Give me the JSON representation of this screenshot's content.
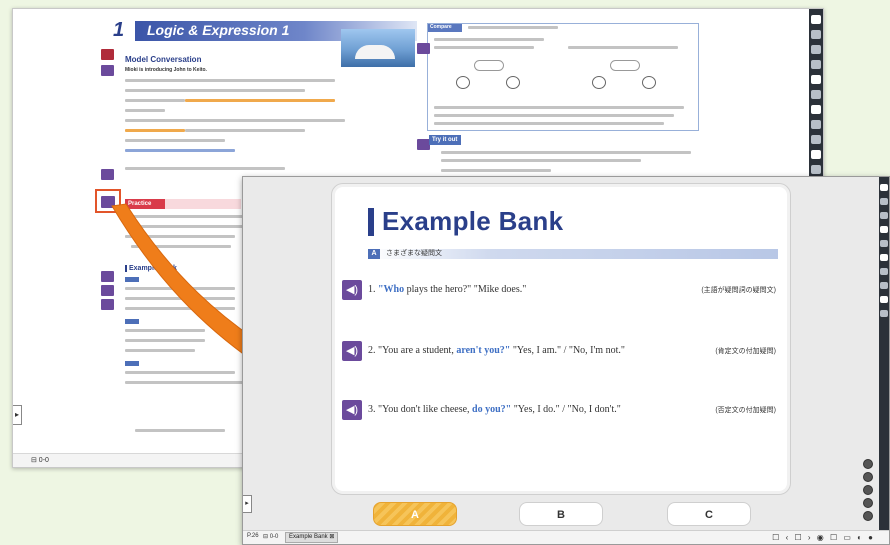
{
  "back_window": {
    "chapter_number": "1",
    "chapter_title": "Logic & Expression 1",
    "conversation_title": "Model Conversation",
    "conversation_subtitle": "Mioki is introducing John to Keito.",
    "compare_label": "Compare",
    "try_it_label": "Try it out",
    "practice_label": "Practice",
    "example_bank_label": "Example Bank",
    "bottom_tag": "⊟ 0-0"
  },
  "front_window": {
    "title": "Example Bank",
    "section": {
      "badge": "A",
      "label": "さまざまな疑問文"
    },
    "examples": [
      {
        "num": "1.",
        "pre": "",
        "hl": "\"Who",
        "post": " plays the hero?\"  \"Mike does.\"",
        "note": "(主語が疑問詞の疑問文)"
      },
      {
        "num": "2.",
        "pre": "\"You are a student, ",
        "hl": "aren't you?\"",
        "post": "  \"Yes, I am.\" / \"No, I'm not.\"",
        "note": "(肯定文の付加疑問)"
      },
      {
        "num": "3.",
        "pre": "\"You don't like cheese, ",
        "hl": "do you?\"",
        "post": "  \"Yes, I do.\" / \"No, I don't.\"",
        "note": "(否定文の付加疑問)"
      }
    ],
    "tabs": [
      {
        "label": "A",
        "active": true
      },
      {
        "label": "B",
        "active": false
      },
      {
        "label": "C",
        "active": false
      }
    ],
    "bottom_bar": {
      "left_item": "P.26",
      "tab_label": "Example Bank ⊠",
      "page_ref": "⊟ 0-0"
    }
  },
  "colors": {
    "accent_navy": "#2a3f8a",
    "audio_purple": "#6b4a9c",
    "highlight_blue": "#3e6fc4",
    "arrow_orange": "#ef7d1a",
    "tab_active_orange": "#f0b33a"
  }
}
